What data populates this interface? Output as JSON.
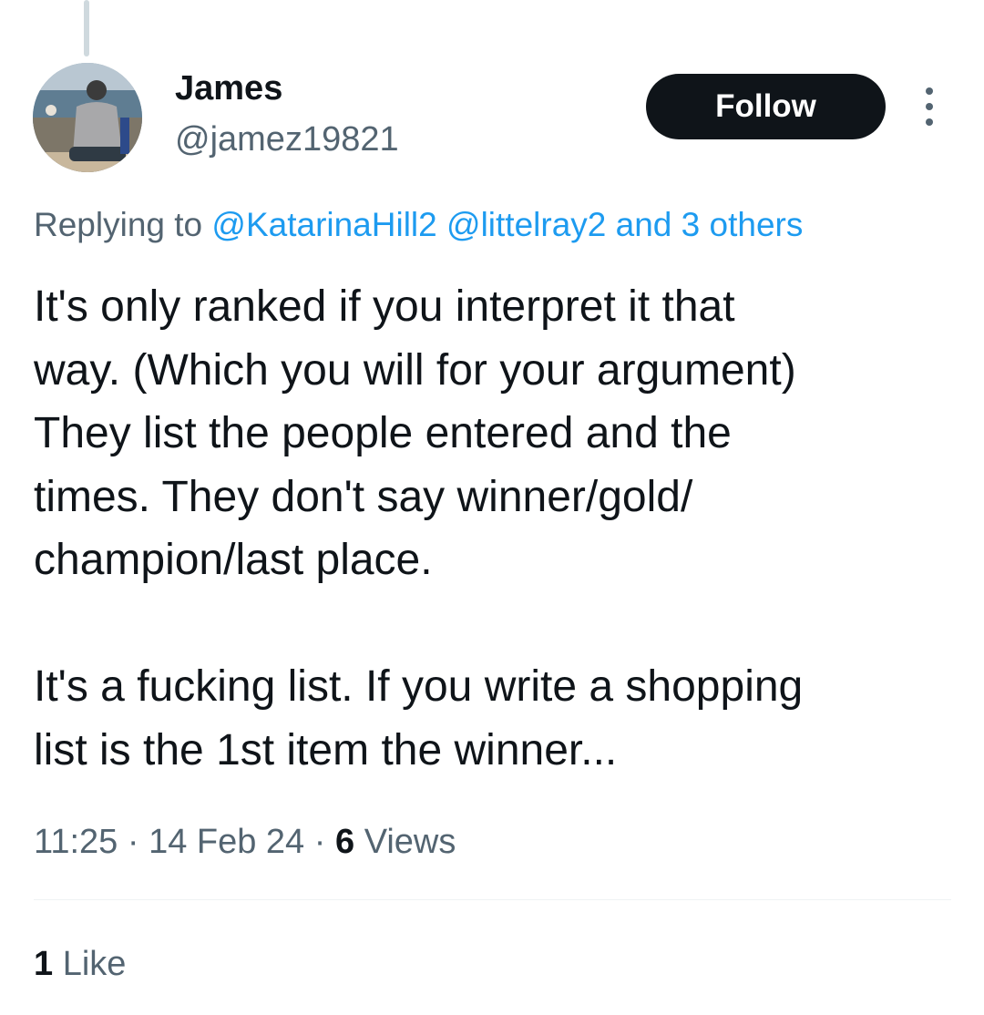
{
  "author": {
    "name": "James",
    "handle": "@jamez19821"
  },
  "follow_label": "Follow",
  "reply_context": {
    "prefix": "Replying to",
    "mention_1": "@KatarinaHill2",
    "mention_2": "@littelray2",
    "others": "and 3 others"
  },
  "tweet_text": "It's only ranked if you interpret it that\nway. (Which you will for your argument)\nThey list the people entered and the\ntimes. They don't say winner/gold/\nchampion/last place.\n\nIt's a fucking list. If you write a shopping\nlist is the 1st item the winner...",
  "meta": {
    "time": "11:25",
    "separator": "·",
    "date": "14 Feb 24",
    "views_count": "6",
    "views_label": "Views"
  },
  "engagement": {
    "likes_count": "1",
    "likes_label": "Like"
  },
  "icons": {
    "more": "more-vertical-icon"
  },
  "colors": {
    "text_primary": "#0f1419",
    "text_secondary": "#536471",
    "link": "#1d9bf0",
    "button_bg": "#0f1419",
    "thread_line": "#cfd9de"
  }
}
